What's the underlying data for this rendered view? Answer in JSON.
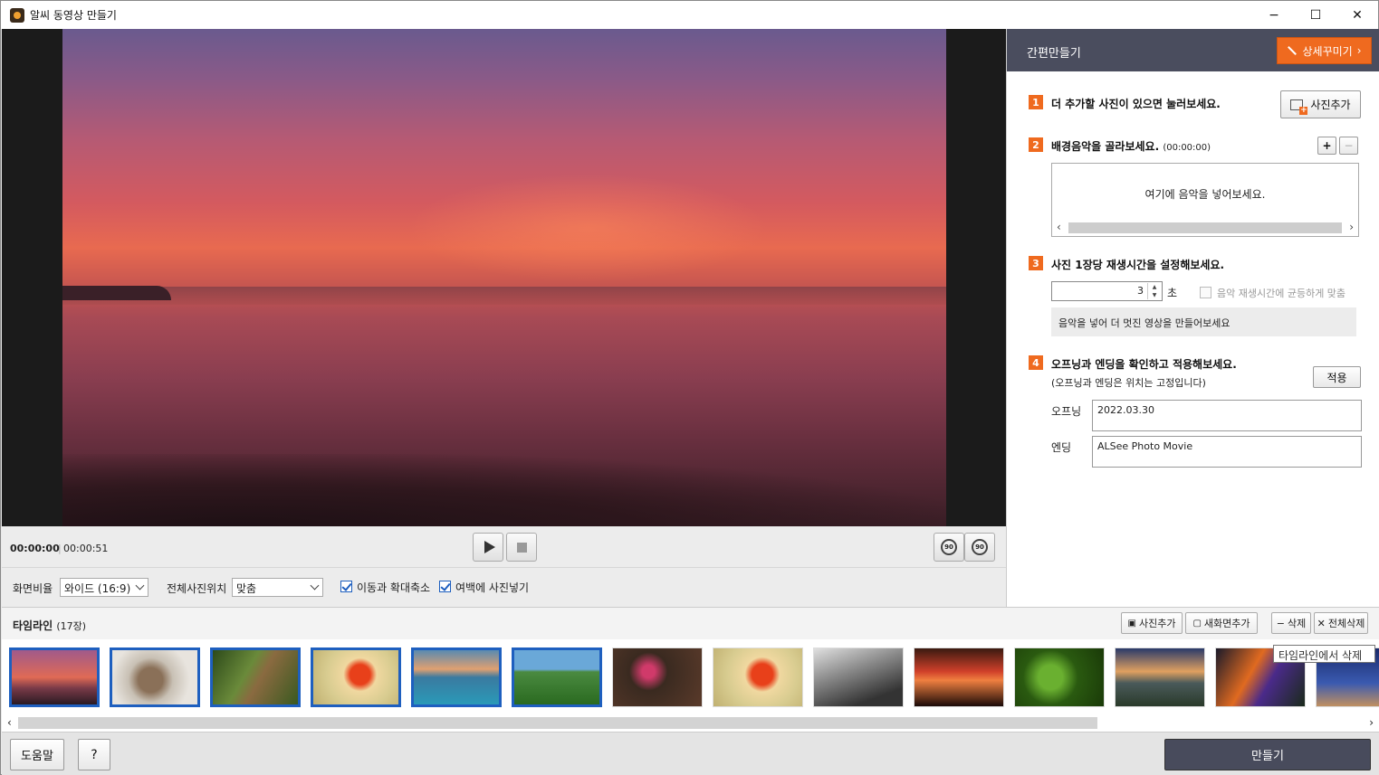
{
  "window": {
    "title": "알씨 동영상 만들기",
    "minimize": "−",
    "maximize": "☐",
    "close": "✕"
  },
  "player": {
    "current_time": "00:00:00",
    "separator": "|",
    "total_time": "00:00:51",
    "rotate_left_label": "90",
    "rotate_right_label": "90"
  },
  "options": {
    "aspect_label": "화면비율",
    "aspect_value": "와이드 (16:9)",
    "position_label": "전체사진위치",
    "position_value": "맞춤",
    "motion_label": "이동과 확대축소",
    "motion_checked": true,
    "fill_label": "여백에 사진넣기",
    "fill_checked": true
  },
  "panel": {
    "title": "간편만들기",
    "detail_button": "상세꾸미기",
    "step1": {
      "num": "1",
      "text": "더 추가할 사진이 있으면 눌러보세요.",
      "button": "사진추가"
    },
    "step2": {
      "num": "2",
      "text": "배경음악을 골라보세요.",
      "duration": "(00:00:00)",
      "add": "+",
      "remove": "−",
      "empty": "여기에 음악을 넣어보세요."
    },
    "step3": {
      "num": "3",
      "text": "사진 1장당 재생시간을 설정해보세요.",
      "value": "3",
      "unit": "초",
      "sync_label": "음악 재생시간에 균등하게 맞춤",
      "hint": "음악을 넣어 더 멋진 영상을 만들어보세요"
    },
    "step4": {
      "num": "4",
      "text": "오프닝과 엔딩을 확인하고 적용해보세요.",
      "sub": "(오프닝과 엔딩은 위치는 고정입니다)",
      "apply": "적용",
      "opening_label": "오프닝",
      "opening_value": "2022.03.30",
      "ending_label": "엔딩",
      "ending_value": "ALSee Photo Movie"
    }
  },
  "timeline": {
    "title": "타임라인",
    "count": "(17장)",
    "add_photo": "사진추가",
    "add_new_screen": "새화면추가",
    "delete": "삭제",
    "delete_all": "전체삭제",
    "tooltip": "타임라인에서 삭제",
    "thumbnails": [
      {
        "theme": "sunset-sea",
        "selected": true
      },
      {
        "theme": "squirrel",
        "selected": true
      },
      {
        "theme": "tree-lizard",
        "selected": true
      },
      {
        "theme": "red-poppy",
        "selected": true
      },
      {
        "theme": "sea-rock",
        "selected": true
      },
      {
        "theme": "green-field",
        "selected": true
      },
      {
        "theme": "pink-flowers",
        "selected": false
      },
      {
        "theme": "red-poppy",
        "selected": false
      },
      {
        "theme": "grey-rocks",
        "selected": false
      },
      {
        "theme": "orange-sky",
        "selected": false
      },
      {
        "theme": "green-frog",
        "selected": false
      },
      {
        "theme": "coast-dusk",
        "selected": false
      },
      {
        "theme": "bird-of-paradise",
        "selected": false
      },
      {
        "theme": "blue-night",
        "selected": false
      }
    ]
  },
  "bottom": {
    "help": "도움말",
    "question": "?",
    "make": "만들기"
  }
}
